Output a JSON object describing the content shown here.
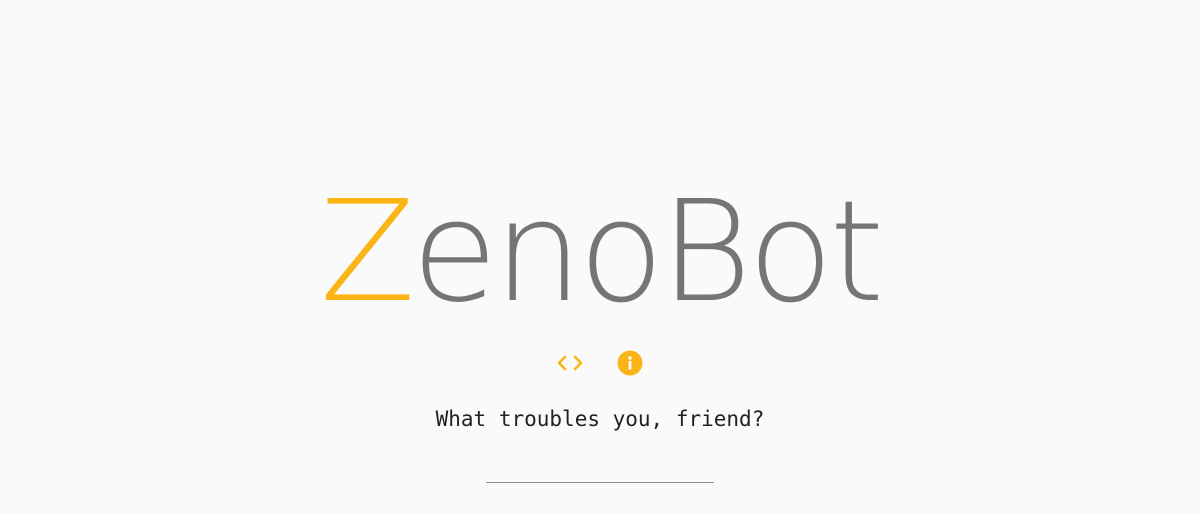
{
  "logo": {
    "first_letter": "Z",
    "rest": "enoBot"
  },
  "icons": {
    "code": "code-icon",
    "info": "info-icon"
  },
  "prompt": {
    "text": "What troubles you, friend?"
  },
  "query": {
    "value": "",
    "placeholder": ""
  },
  "colors": {
    "accent": "#fbb415",
    "logo_text": "#757575",
    "background": "#fafafa",
    "prompt_text": "#222222",
    "input_underline": "#8a8a8a"
  }
}
